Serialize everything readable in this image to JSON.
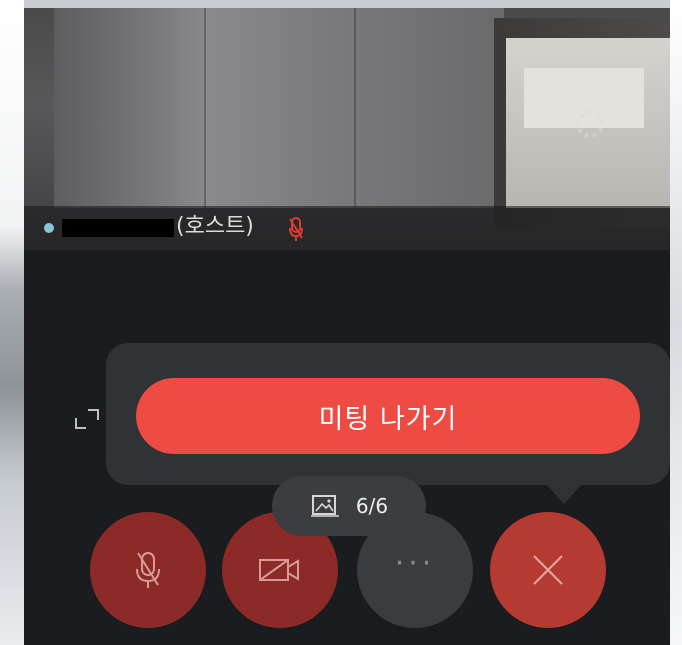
{
  "participant": {
    "role_tag": "(호스트)"
  },
  "leave_popup": {
    "leave_button_label": "미팅 나가기"
  },
  "page_indicator": {
    "count": "6/6"
  },
  "controls": {
    "more_label": "···"
  },
  "icons": {
    "status_dot": "status-dot-icon",
    "mic_muted": "mic-muted-icon",
    "fullscreen": "fullscreen-icon",
    "gallery": "gallery-icon",
    "mic_off": "mic-off-icon",
    "camera_off": "camera-off-icon",
    "more": "more-icon",
    "close": "close-icon"
  },
  "colors": {
    "leave_button": "#ee4b42",
    "mute_red": "#8b2a27",
    "end_red": "#b53a31",
    "panel": "#303235",
    "background": "#1b1c1f"
  }
}
